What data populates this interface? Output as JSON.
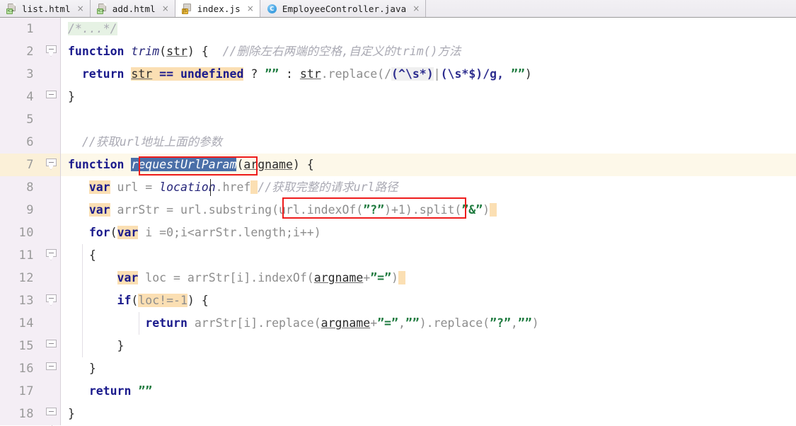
{
  "window": {
    "app": "IDE code editor",
    "active_tab_index": 2
  },
  "tabs": [
    {
      "label": "list.html",
      "icon": "html-file-icon",
      "badge": "<>",
      "close": "×",
      "active": false
    },
    {
      "label": "add.html",
      "icon": "html-file-icon",
      "badge": "<>",
      "close": "×",
      "active": false
    },
    {
      "label": "index.js",
      "icon": "js-file-icon",
      "badge": "JS",
      "close": "×",
      "active": true
    },
    {
      "label": "EmployeeController.java",
      "icon": "java-file-icon",
      "badge": "C",
      "close": "×",
      "active": false
    }
  ],
  "editor": {
    "current_line": 7,
    "line_numbers": [
      "1",
      "2",
      "3",
      "4",
      "5",
      "6",
      "7",
      "8",
      "9",
      "10",
      "11",
      "12",
      "13",
      "14",
      "15",
      "16",
      "17",
      "18"
    ],
    "lines": [
      {
        "n": "1",
        "text": "    /*...*/"
      },
      {
        "n": "2",
        "text": "function trim(str) {   //删除左右两端的空格,自定义的trim()方法"
      },
      {
        "n": "3",
        "text": "    return str == undefined ? ”” : str.replace(/(^\\s*)|(\\s*$)/g, ””)"
      },
      {
        "n": "4",
        "text": "}"
      },
      {
        "n": "5",
        "text": ""
      },
      {
        "n": "6",
        "text": "    //获取url地址上面的参数"
      },
      {
        "n": "7",
        "text": "function requestUrlParam(argname) {"
      },
      {
        "n": "8",
        "text": "    var url = location.href  //获取完整的请求url路径"
      },
      {
        "n": "9",
        "text": "    var arrStr = url.substring(url.indexOf(”?”)+1).split(”&”)"
      },
      {
        "n": "10",
        "text": "    for(var i =0;i<arrStr.length;i++)"
      },
      {
        "n": "11",
        "text": "    {"
      },
      {
        "n": "12",
        "text": "        var loc = arrStr[i].indexOf(argname+”=”)"
      },
      {
        "n": "13",
        "text": "        if(loc!=-1) {"
      },
      {
        "n": "14",
        "text": "            return arrStr[i].replace(argname+”=”,””).replace(”?”,””)"
      },
      {
        "n": "15",
        "text": "        }"
      },
      {
        "n": "16",
        "text": "    }"
      },
      {
        "n": "17",
        "text": "    return ””"
      },
      {
        "n": "18",
        "text": "}"
      }
    ],
    "selection": {
      "text": "requestUrlParam",
      "line": 7,
      "description": "selected identifier highlighted blue"
    },
    "annotations": [
      {
        "name": "red-box-function-name",
        "target": "requestUrlParam",
        "line": 7
      },
      {
        "name": "red-box-comment",
        "target": "获取完整的请求url路径",
        "line": 8
      }
    ]
  },
  "tokens": {
    "l1_comment": "/*...*/",
    "l2_kw": "function",
    "l2_name": "trim",
    "l2_paren_open": "(",
    "l2_arg": "str",
    "l2_paren_close": ")",
    "l2_brace": " {",
    "l2_comment": "  //删除左右两端的空格,自定义的trim()方法",
    "l3_return": "return",
    "l3_str": "str",
    "l3_eq": "==",
    "l3_undef": "undefined",
    "l3_q": " ? ",
    "l3_empty1": "””",
    "l3_colon": " : ",
    "l3_strv": "str",
    "l3_replace": ".replace(/",
    "l3_rx1": "(^\\s*)",
    "l3_pipe": "|",
    "l3_rx2": "(\\s*$)",
    "l3_rxend": "/g, ",
    "l3_empty2": "””",
    "l3_close": ")",
    "l4_brace": "}",
    "l6_comment": "//获取url地址上面的参数",
    "l7_kw": "function",
    "l7_name": "requestUrlParam",
    "l7_open": "(",
    "l7_arg": "argname",
    "l7_close": ") {",
    "l8_var": "var",
    "l8_name": " url = ",
    "l8_loc": "location",
    "l8_href": ".href",
    "l8_comment_slash": "//",
    "l8_comment_text": "获取完整的请求url路径",
    "l9_var": "var",
    "l9_rest1": " arrStr = url.substring(url.indexOf(",
    "l9_q1": "”?”",
    "l9_rest2": ")+1).split(",
    "l9_q2": "”&”",
    "l9_rest3": ")",
    "l10_for": "for",
    "l10_p1": "(",
    "l10_var": "var",
    "l10_rest": " i =0;i<arrStr.length;i++)",
    "l11_brace": "{",
    "l12_var": "var",
    "l12_rest1": " loc = arrStr[i].indexOf(",
    "l12_arg": "argname",
    "l12_plus": "+",
    "l12_q": "”=”",
    "l12_rest2": ")",
    "l13_if": "if",
    "l13_p1": "(",
    "l13_cond": "loc!=-1",
    "l13_p2": ")",
    "l13_brace": " {",
    "l14_return": "return",
    "l14_rest1": " arrStr[i].replace(",
    "l14_arg": "argname",
    "l14_plus": "+",
    "l14_q1": "”=”",
    "l14_comma": ",",
    "l14_q2": "””",
    "l14_rest2": ").replace(",
    "l14_q3": "”?”",
    "l14_comma2": ",",
    "l14_q4": "””",
    "l14_rest3": ")",
    "l15_brace": "}",
    "l16_brace": "}",
    "l17_return": "return",
    "l17_str": "””",
    "l18_brace": "}"
  },
  "colors": {
    "keyword": "#1a1a8c",
    "comment": "#a9a9b3",
    "string": "#1d7a3e",
    "gutter_bg": "#f4eef5",
    "current_line_bg": "#fdf6e3",
    "occurrence_hl": "#fbdfb3",
    "selection_bg": "#4a6fa8",
    "annotation_red": "#ee1c1c",
    "editor_bg": "#ffffff"
  }
}
